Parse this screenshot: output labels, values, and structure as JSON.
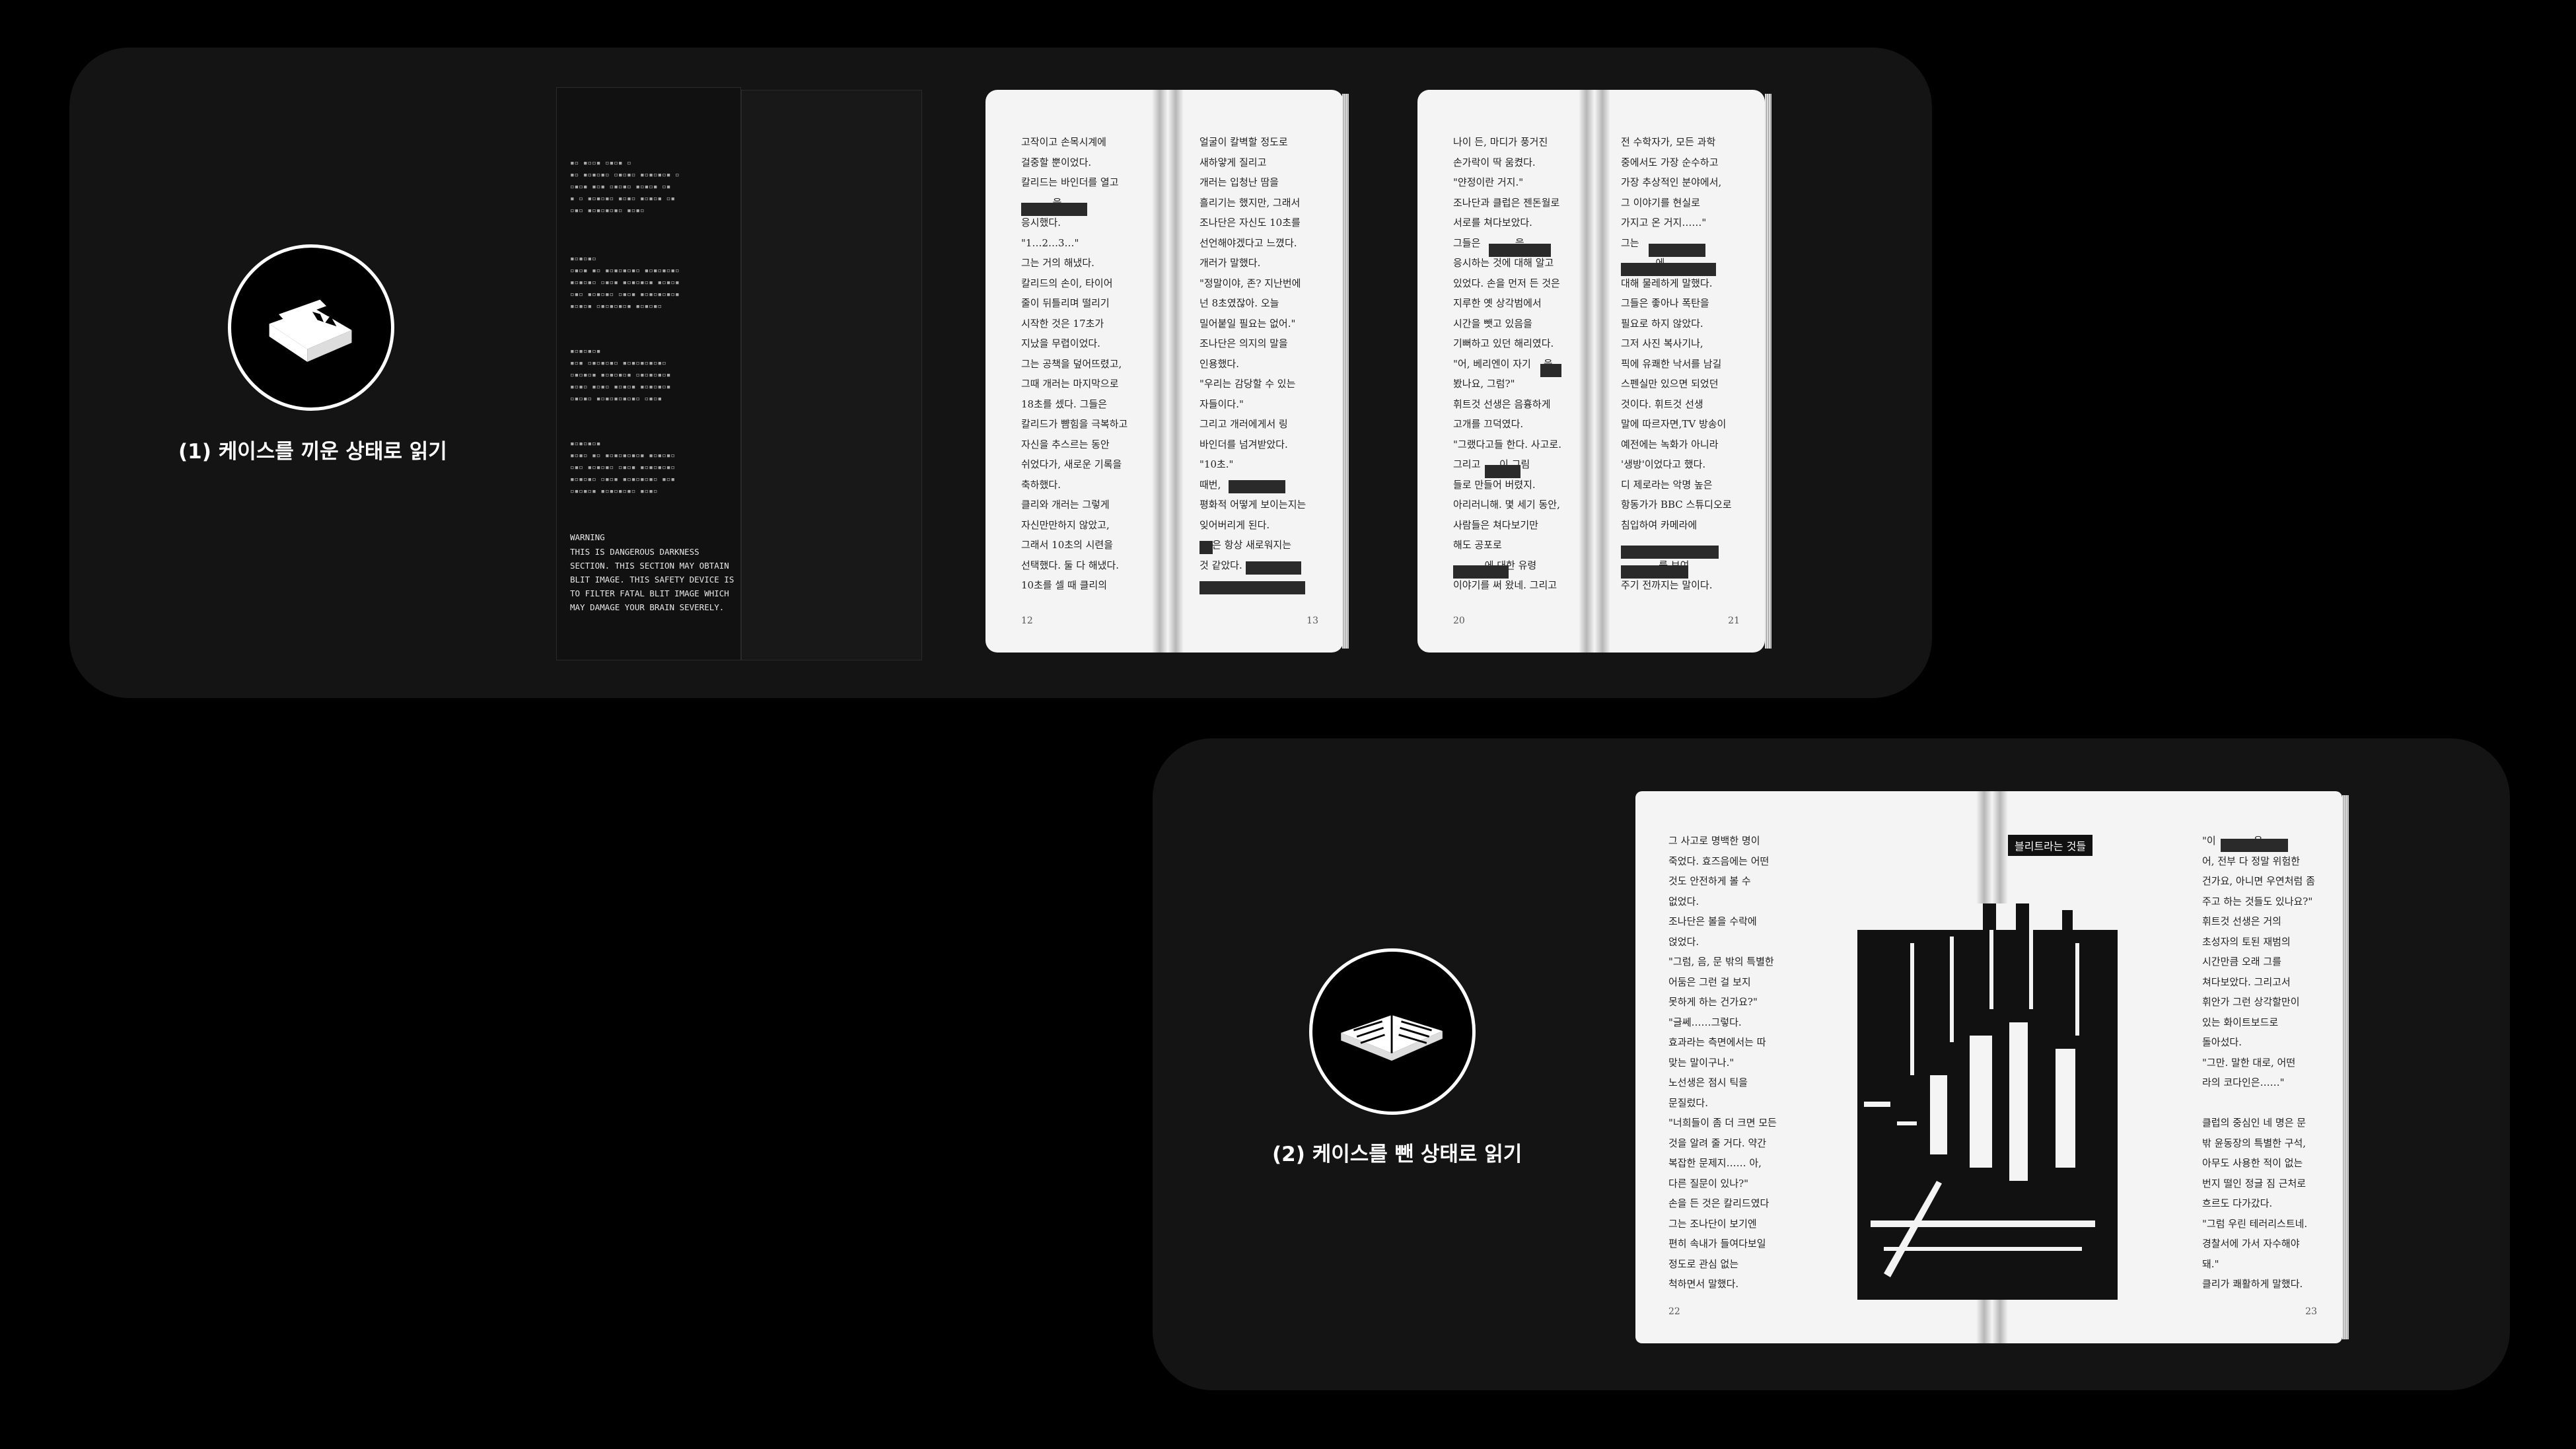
{
  "modes": [
    {
      "caption": "(1) 케이스를 끼운 상태로 읽기",
      "icon": "book-in-case-icon"
    },
    {
      "caption": "(2) 케이스를 뺀 상태로 읽기",
      "icon": "open-book-icon"
    }
  ],
  "case_cover": {
    "warning_heading": "WARNING",
    "warning_text": "THIS IS DANGEROUS DARKNESS\nSECTION. THIS SECTION MAY OBTAIN\nBLIT IMAGE. THIS SAFETY DEVICE IS\nTO FILTER FATAL BLIT IMAGE WHICH\nMAY DAMAGE YOUR BRAIN SEVERELY."
  },
  "spreads": [
    {
      "left_page_number": "12",
      "right_page_number": "13",
      "left_text": "고작이고 손목시계에\n걸중할 뿐이었다.\n칼리드는 바인더를 열고\n          을\n응시했다.\n\"1…2…3…\"\n그는 거의 해냈다.\n칼리드의 손이, 타이어\n줄이 뒤틀리며 떨리기\n시작한 것은 17초가\n지났을 무렵이었다.\n그는 공책을 덮어뜨렸고,\n그때 개러는 마지막으로\n18초를 셌다. 그들은\n칼리드가 뺨힘을 극복하고\n자신을 추스르는 동안\n쉬었다가, 새로운 기록을\n축하했다.\n클리와 개러는 그렇게\n자신만만하지 않았고,\n그래서 10초의 시련을\n선택했다. 둘 다 해냈다.\n10초를 셀 때 클리의",
      "right_text": "얼굴이 칼벽할 정도로\n새하얗게 질리고\n개러는 입청난 땀을\n흘리기는 했지만, 그래서\n조나단은 자신도 10초를\n선언해야겠다고 느꼈다.\n개러가 말했다.\n\"정말이야, 존? 지난번에\n넌 8초였잖아. 오늘\n밀어붙일 필요는 없어.\"\n조나단은 의지의 말을\n인용했다.\n\"우리는 감당할 수 있는\n자들이다.\"\n그리고 개러에게서 링\n바인더를 넘겨받았다.\n\"10초.\"\n때번,\n평화적 어떻게 보이는지는\n잊어버리게 된다.\n    은 항상 새로워지는\n것 같았다."
    },
    {
      "left_page_number": "20",
      "right_page_number": "21",
      "left_text": "나이 든, 마디가 풍거진\n손가락이 딱 움켰다.\n\"얀정이란 거지.\"\n조나단과 클럽은 젠돈월로\n서로를 쳐다보았다.\n그들은           을\n응시하는 것에 대해 알고\n있었다. 손을 먼저 든 것은\n지루한 옛 상각범에서\n시간을 뺏고 있음을\n기뻐하고 있던 해리였다.\n\"어, 베리엔이 자기    을\n봤나요, 그럼?\"\n휘트것 선생은 음흉하게\n고개를 끄덕였다.\n\"그랬다고들 한다. 사고로.\n그리고      이 그림\n들로 만들어 버렸지.\n아리러니해. 몇 세기 동안,\n사람들은 쳐다보기만\n해도 공포로\n          에 대한 유령\n이야기를 써 왔네. 그리고",
      "right_text": "전 수학자가, 모든 과학\n중에서도 가장 순수하고\n가장 추상적인 분야에서,\n그 이야기를 현실로\n가지고 온 거지……\"\n그는           \n           에\n대해 물레하게 말했다.\n그들은 좋아나 폭탄을\n필요로 하지 않았다.\n그저 사진 복사기나,\n픽에 유쾌한 낙서를 남길\n스펜실만 있으면 되었던\n것이다. 휘트것 선생\n말에 따르자면,TV 방송이\n예전에는 녹화가 아니라\n'생방'이었다고 했다.\n디 제로라는 악명 높은\n항동가가 BBC 스튜디오로\n침입하여 카메라에\n            \n            를 보여\n주기 전까지는 말이다."
    },
    {
      "left_page_number": "22",
      "right_page_number": "23",
      "illustration_title": "블리트라는 것들",
      "left_text": "그 사고로 명백한 명이\n죽었다. 효즈음에는 어떤\n것도 안전하게 볼 수\n없었다.\n조나단은 볼을 수락에\n얹었다.\n\"그럼, 음, 문 밖의 특별한\n어둠은 그런 걸 보지\n못하게 하는 건가요?\"\n\"글쎄……그렇다.\n효과라는 측면에서는 따\n맞는 말이구나.\"\n노선생은 점시 틱을\n문질렀다.\n\"너희들이 좀 더 크면 모든\n것을 알려 줄 거다. 약간\n복잡한 문제지…… 아,\n다른 질문이 있나?\"\n손을 든 것은 칼리드였다\n그는 조나단이 보기엔\n편히 속내가 들여다보일\n정도로 관심 없는\n척하면서 말했다.",
      "right_text": "\"이            은,\n어, 전부 다 정말 위험한\n건가요, 아니면 우연처럼 좀\n주고 하는 것들도 있나요?\"\n휘트것 선생은 거의\n초성자의 토된 재범의\n시간만큼 오래 그를\n쳐다보았다. 그리고서\n휘안가 그런 상각할만이\n있는 화이트보드로\n돌아섰다.\n\"그만. 말한 대로, 어떤\n라의 코다인은……\"\n\n클럽의 중심인 네 명은 문\n밖 윤동장의 특별한 구석,\n아무도 사용한 적이 없는\n번지 떨인 정글 짐 근처로\n흐르도 다가갔다.\n\"그럼 우린 테러리스트네.\n경찰서에 가서 자수해야\n돼.\"\n클리가 쾌활하게 말했다."
    }
  ]
}
